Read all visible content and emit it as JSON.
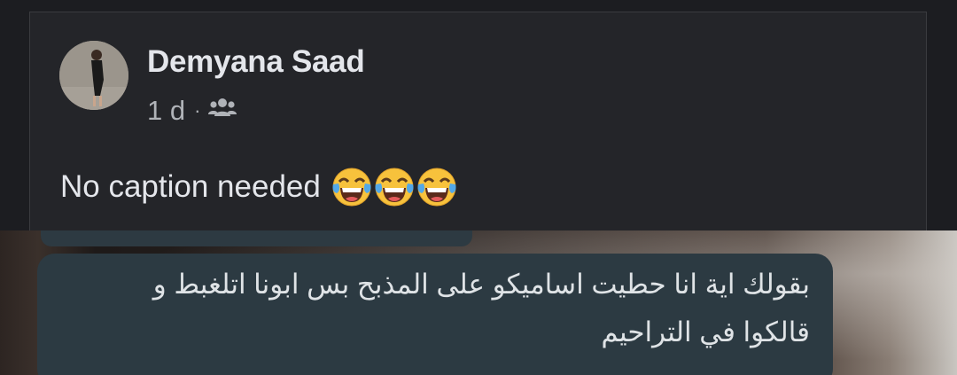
{
  "post": {
    "author": "Demyana Saad",
    "time": "1 d",
    "separator": "·",
    "audience_icon": "friends-icon",
    "caption": "No caption needed",
    "caption_emojis": [
      "tears-of-joy-emoji",
      "tears-of-joy-emoji",
      "tears-of-joy-emoji"
    ]
  },
  "photo": {
    "message_lines": [
      "بقولك اية انا حطيت اساميكو على المذبح بس ابونا اتلغبط و",
      "قالكوا في التراحيم"
    ]
  }
}
